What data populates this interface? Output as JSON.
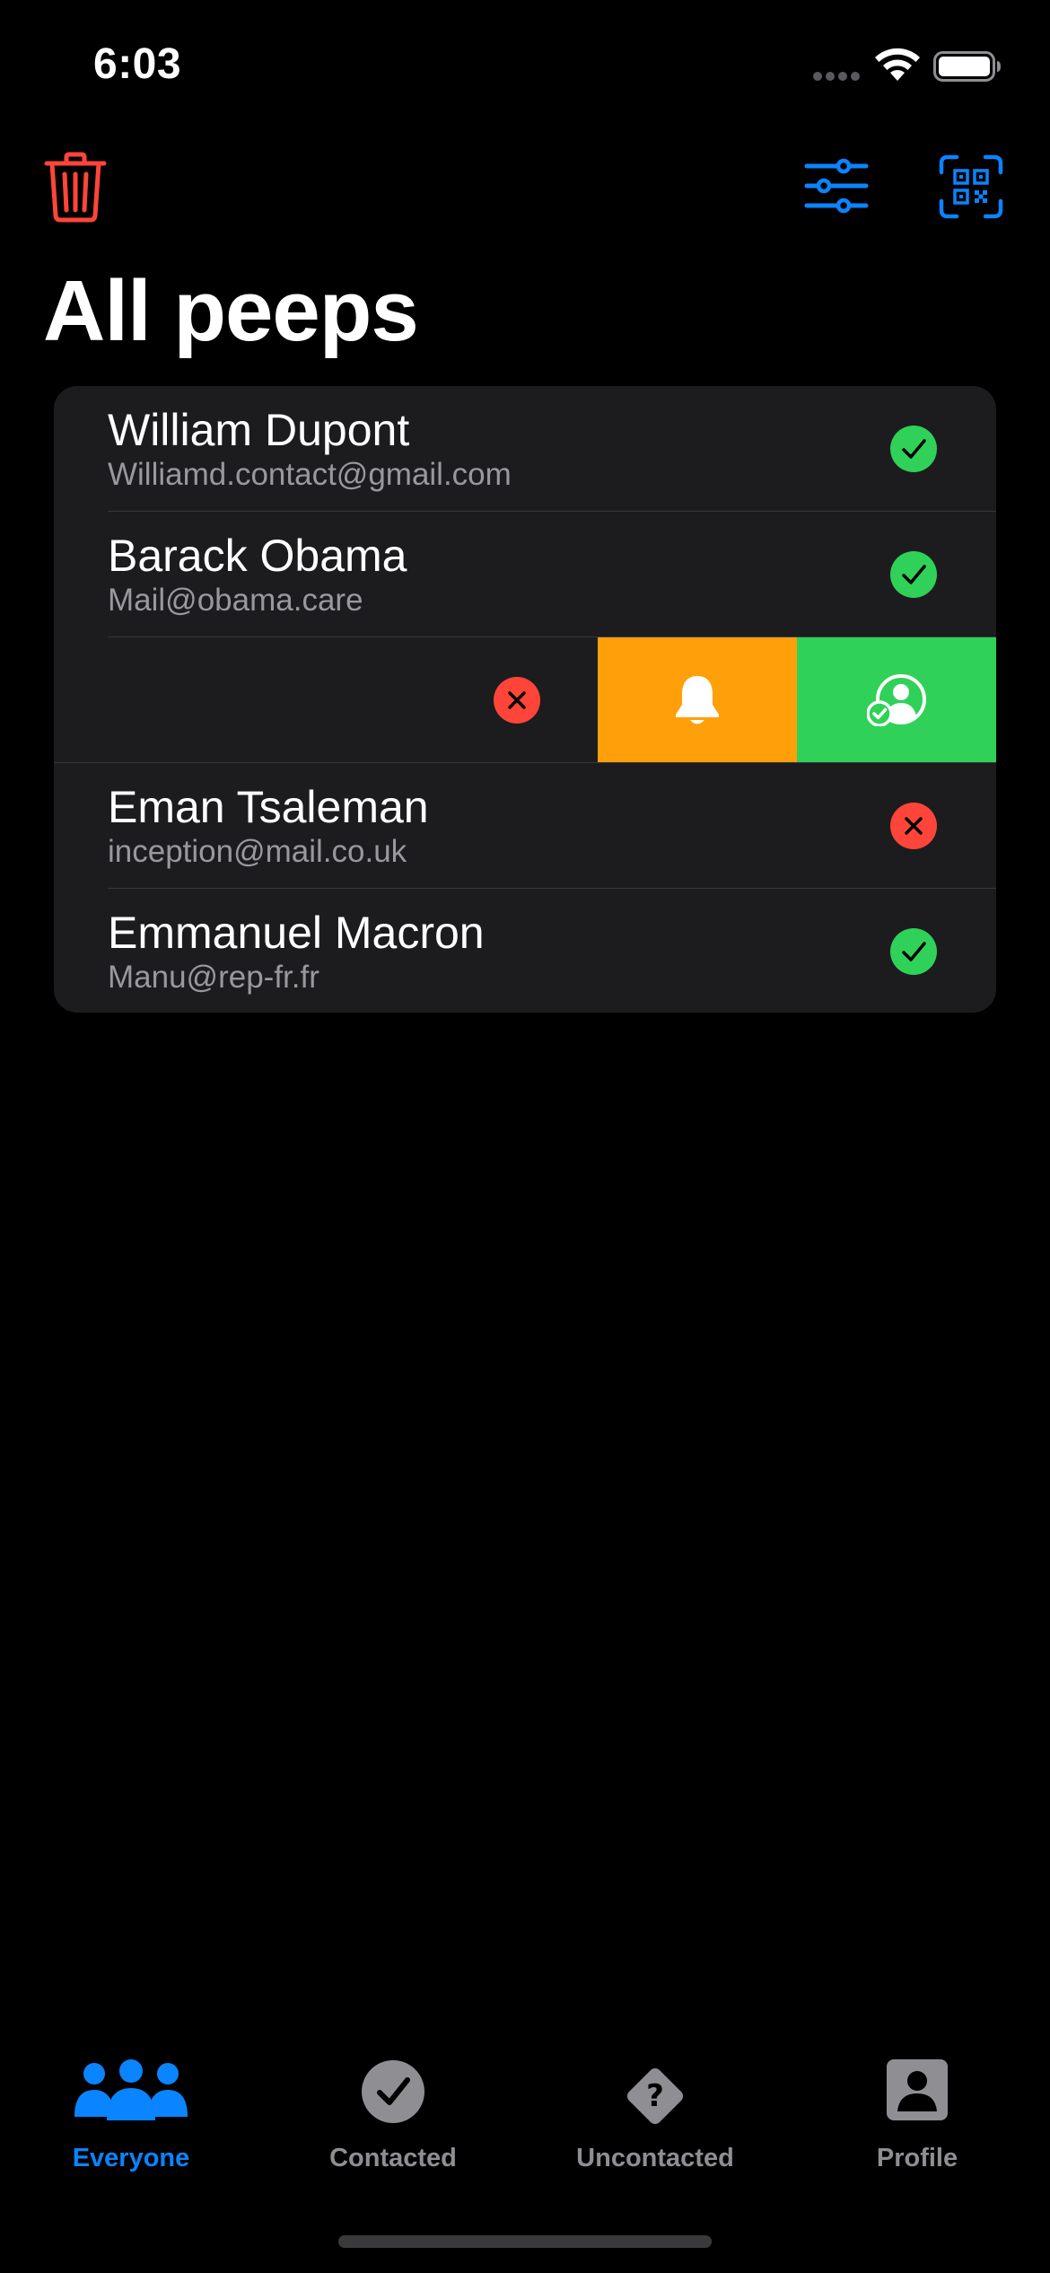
{
  "status_bar": {
    "time": "6:03",
    "icons": [
      "signal-icon",
      "wifi-icon",
      "battery-icon"
    ]
  },
  "nav": {
    "title": "All peeps",
    "icons": {
      "trash": "trash-icon",
      "filter": "sliders-icon",
      "qr": "qr-code-scan-icon"
    }
  },
  "contacts": [
    {
      "name": "William Dupont",
      "email": "Williamd.contact@gmail.com",
      "status": "contacted"
    },
    {
      "name": "Barack Obama",
      "email": "Mail@obama.care",
      "status": "contacted"
    },
    {
      "name": "",
      "email": "",
      "status": "uncontacted",
      "swiped": true
    },
    {
      "name": "Eman Tsaleman",
      "email": "inception@mail.co.uk",
      "status": "uncontacted"
    },
    {
      "name": "Emmanuel Macron",
      "email": "Manu@rep-fr.fr",
      "status": "contacted"
    }
  ],
  "swipe_actions": [
    {
      "icon": "bell-icon",
      "color": "#ff9f0a"
    },
    {
      "icon": "person-checkmark-icon",
      "color": "#30d158"
    }
  ],
  "tab_bar": {
    "tabs": [
      {
        "label": "Everyone",
        "icon": "people-icon",
        "active": true
      },
      {
        "label": "Contacted",
        "icon": "checkmark-circle-icon",
        "active": false
      },
      {
        "label": "Uncontacted",
        "icon": "question-diamond-icon",
        "active": false
      },
      {
        "label": "Profile",
        "icon": "person-square-icon",
        "active": false
      }
    ]
  },
  "colors": {
    "accent": "#0a84ff",
    "destructive": "#ff453a",
    "success": "#30d158",
    "warning": "#ff9f0a",
    "card": "#1c1c1e",
    "background": "#000000"
  }
}
